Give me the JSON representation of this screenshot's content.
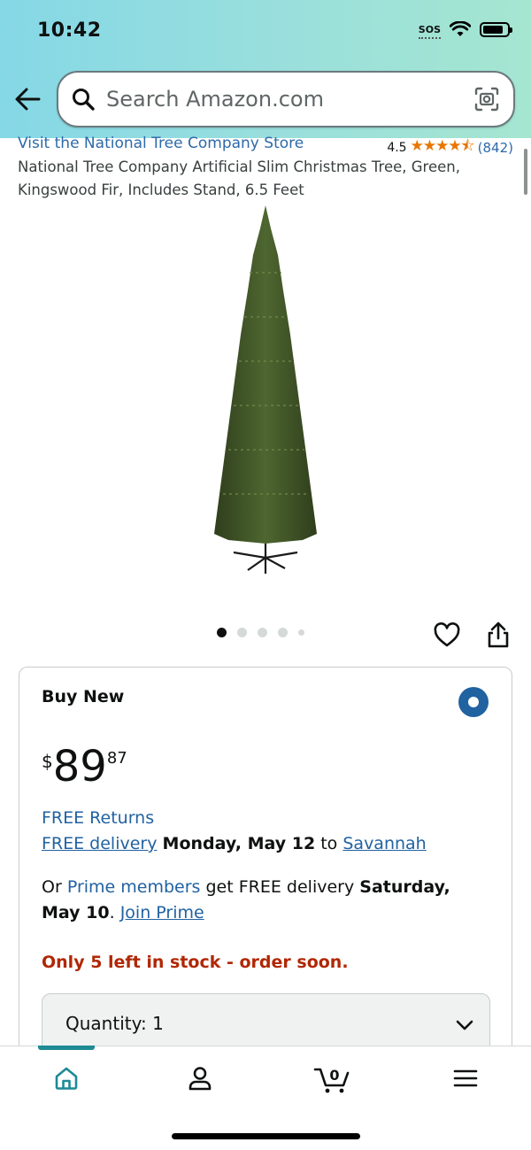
{
  "status_bar": {
    "time": "10:42",
    "sos": "SOS"
  },
  "search": {
    "placeholder": "Search Amazon.com"
  },
  "product": {
    "store_link": "Visit the National Tree Company Store",
    "rating_value": "4.5",
    "rating_stars": 4.5,
    "review_count": "(842)",
    "title": "National Tree Company Artificial Slim Christmas Tree, Green, Kingswood Fir, Includes Stand, 6.5 Feet"
  },
  "gallery": {
    "image_count": 5,
    "active_index": 0
  },
  "buy_box": {
    "label": "Buy New",
    "price_symbol": "$",
    "price_whole": "89",
    "price_fraction": "87",
    "free_returns": "FREE Returns",
    "delivery_link": "FREE delivery",
    "delivery_date": "Monday, May 12",
    "delivery_to": "to",
    "delivery_location": "Savannah",
    "prime_or": "Or",
    "prime_members": "Prime members",
    "prime_text": "get FREE delivery",
    "prime_date": "Saturday, May 10",
    "prime_period": ".",
    "join_prime": "Join Prime",
    "stock": "Only 5 left in stock - order soon.",
    "quantity_label": "Quantity:",
    "quantity_value": "1"
  },
  "bottom_nav": {
    "cart_count": "0",
    "active": "home"
  },
  "colors": {
    "accent_blue": "#2162a1",
    "link_blue": "#2d6aa8",
    "star_orange": "#e77600",
    "stock_red": "#b12704",
    "nav_teal": "#1d8a95"
  }
}
